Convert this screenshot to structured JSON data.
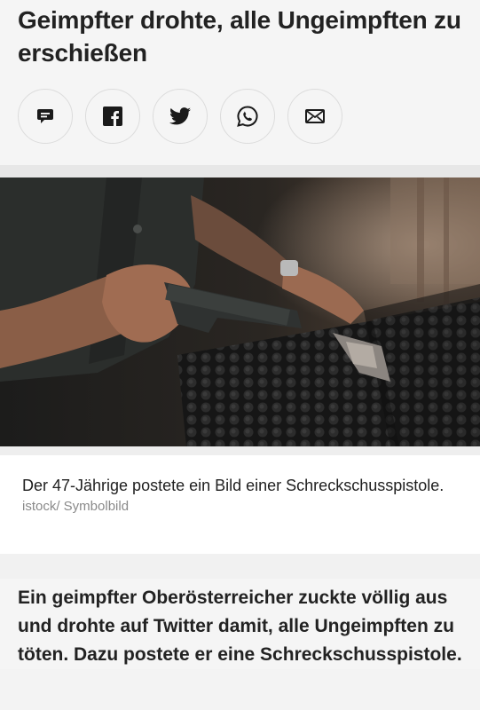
{
  "article": {
    "headline": "Geimpfter drohte, alle Ungeimpften zu erschießen",
    "share": {
      "buttons": [
        {
          "icon": "comment-icon",
          "label": "Kommentare"
        },
        {
          "icon": "facebook-icon",
          "label": "Facebook"
        },
        {
          "icon": "twitter-icon",
          "label": "Twitter"
        },
        {
          "icon": "whatsapp-icon",
          "label": "WhatsApp"
        },
        {
          "icon": "mail-icon",
          "label": "E-Mail"
        }
      ]
    },
    "image": {
      "caption": "Der 47-Jährige postete ein Bild einer Schreckschusspistole.",
      "credit": "istock/ Symbolbild"
    },
    "lead": "Ein geimpfter Oberösterreicher zuckte völlig aus und drohte auf Twitter damit, alle Ungeimpften zu töten. Dazu postete er eine Schreckschusspistole."
  }
}
